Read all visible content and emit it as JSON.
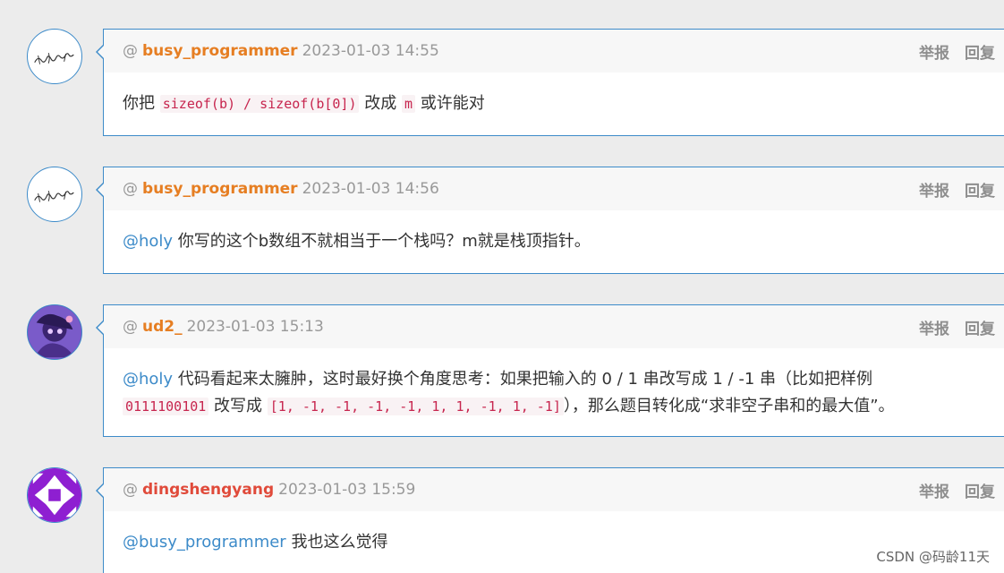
{
  "comments": [
    {
      "at": "@",
      "user": "busy_programmer",
      "time": "2023-01-03 14:55",
      "report": "举报",
      "reply": "回复",
      "body": {
        "t1": "你把 ",
        "code1": "sizeof(b) / sizeof(b[0])",
        "t2": " 改成 ",
        "code2": "m",
        "t3": " 或许能对"
      }
    },
    {
      "at": "@",
      "user": "busy_programmer",
      "time": "2023-01-03 14:56",
      "report": "举报",
      "reply": "回复",
      "body": {
        "mention": "@holy",
        "t1": " 你写的这个b数组不就相当于一个栈吗？m就是栈顶指针。"
      }
    },
    {
      "at": "@",
      "user": "ud2_",
      "time": "2023-01-03 15:13",
      "report": "举报",
      "reply": "回复",
      "body": {
        "mention": "@holy",
        "t1": " 代码看起来太臃肿，这时最好换个角度思考：如果把输入的 0 / 1 串改写成 1 / -1 串（比如把样例",
        "code1": "0111100101",
        "t2": " 改写成 ",
        "code2": "[1, -1, -1, -1, -1, 1, 1, -1, 1, -1]",
        "t3": "），那么题目转化成“求非空子串和的最大值”。"
      }
    },
    {
      "at": "@",
      "user": "dingshengyang",
      "time": "2023-01-03 15:59",
      "report": "举报",
      "reply": "回复",
      "body": {
        "mention": "@busy_programmer",
        "t1": " 我也这么觉得"
      }
    }
  ],
  "watermark": "CSDN @码龄11天",
  "colors": {
    "accent_border": "#3d8bc9",
    "username_orange": "#e67e22",
    "username_red": "#e04a3a",
    "mention_blue": "#3d8bc9",
    "code_red": "#c7254e"
  },
  "icons": {
    "avatar_1": "handwriting-signature-avatar",
    "avatar_2": "handwriting-signature-avatar",
    "avatar_3": "purple-anime-character-avatar",
    "avatar_4": "purple-geometric-identicon-avatar"
  }
}
